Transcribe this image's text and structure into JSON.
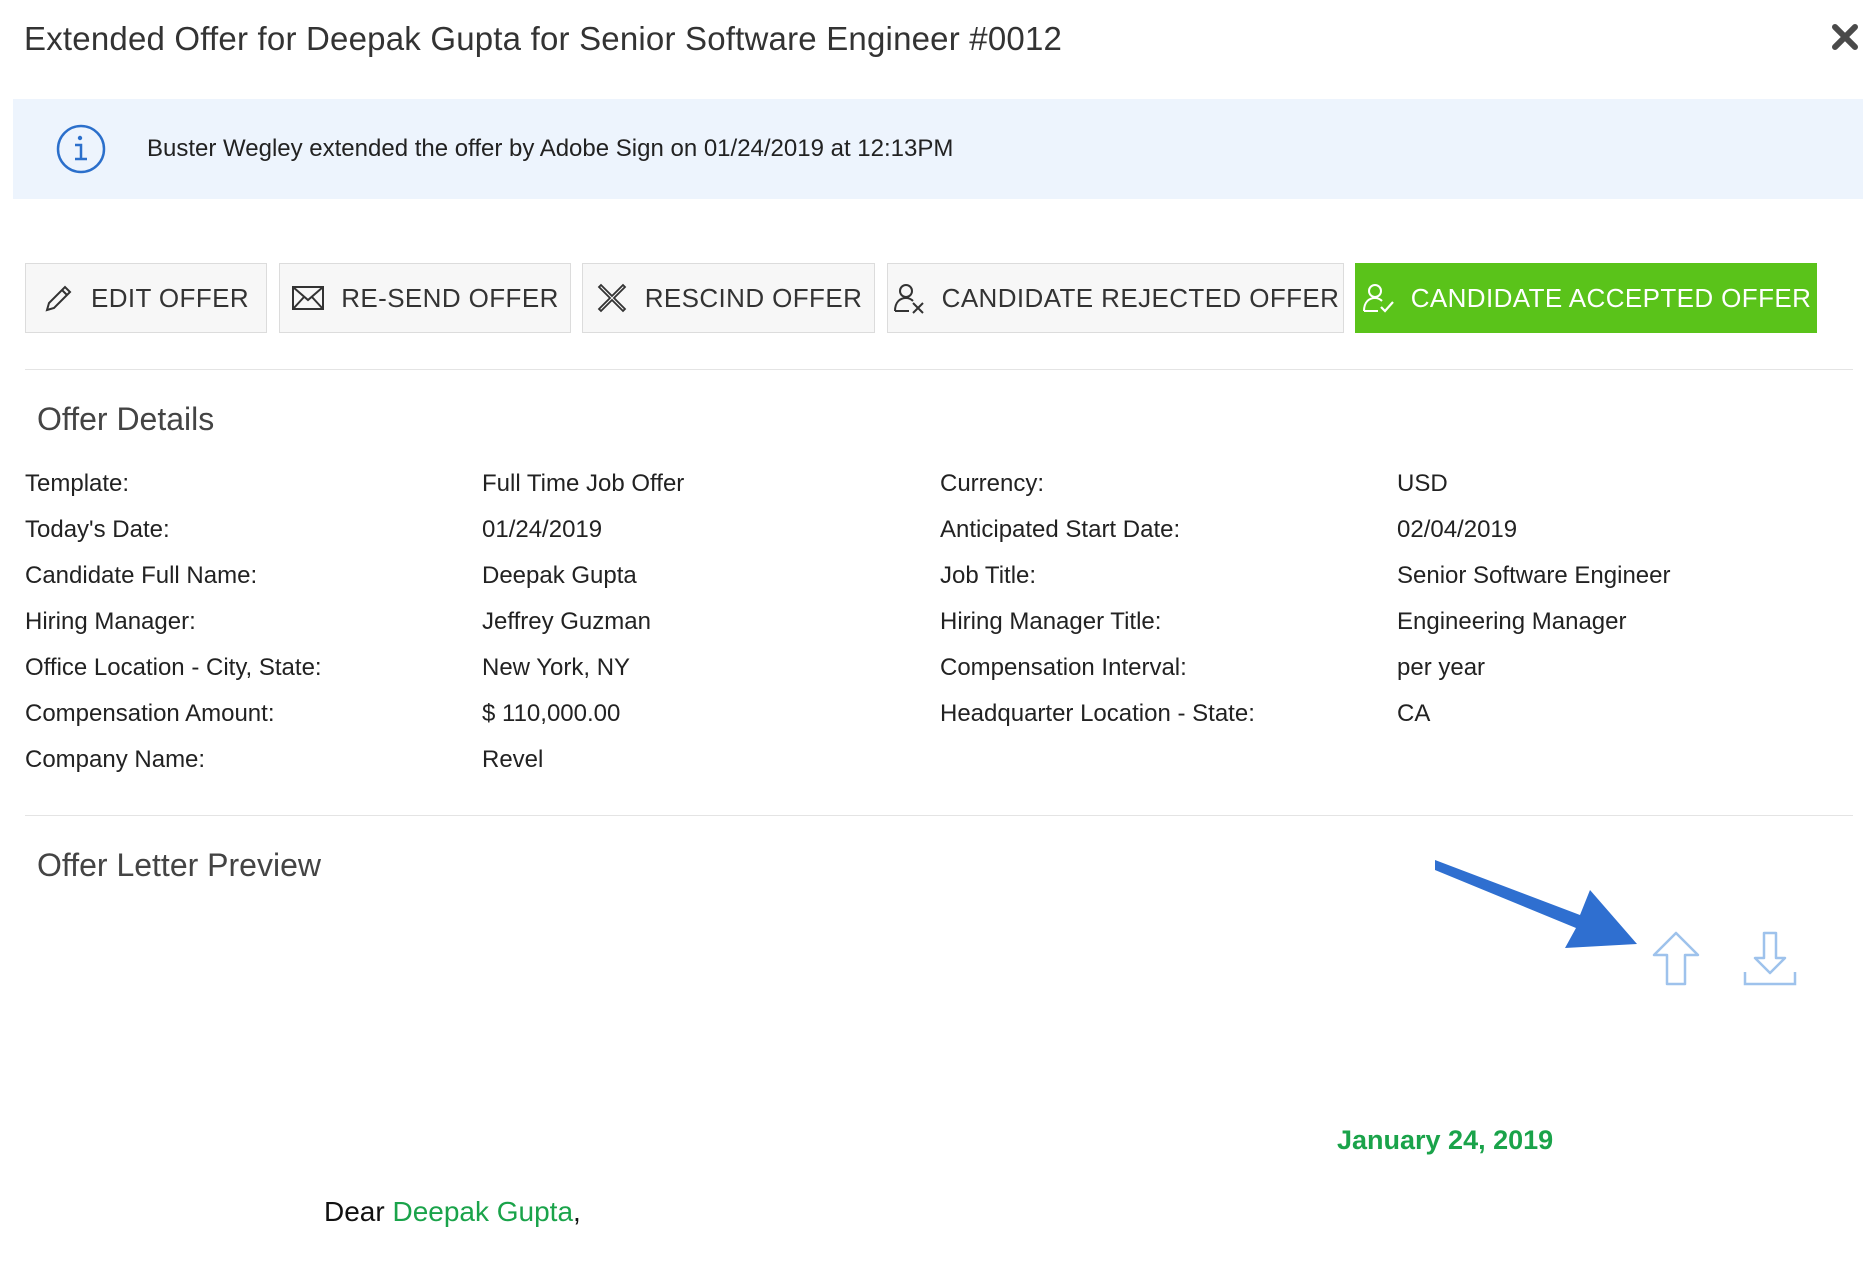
{
  "modal": {
    "title": "Extended Offer for Deepak Gupta for Senior Software Engineer #0012",
    "close_icon": "close-x-icon"
  },
  "banner": {
    "icon": "info-circle-icon",
    "text": "Buster Wegley extended the offer by Adobe Sign on 01/24/2019 at 12:13PM",
    "color": "#edf4fd"
  },
  "actions": {
    "edit": {
      "label": "EDIT OFFER",
      "icon": "pencil-icon"
    },
    "resend": {
      "label": "RE-SEND OFFER",
      "icon": "envelope-icon"
    },
    "rescind": {
      "label": "RESCIND OFFER",
      "icon": "x-cross-icon"
    },
    "rejected": {
      "label": "CANDIDATE REJECTED OFFER",
      "icon": "user-x-icon"
    },
    "accepted": {
      "label": "CANDIDATE ACCEPTED OFFER",
      "icon": "user-check-icon",
      "color": "#5ac31a"
    }
  },
  "offer_details": {
    "heading": "Offer Details",
    "left": [
      {
        "label": "Template:",
        "value": "Full Time Job Offer"
      },
      {
        "label": "Today's Date:",
        "value": "01/24/2019"
      },
      {
        "label": "Candidate Full Name:",
        "value": "Deepak Gupta"
      },
      {
        "label": "Hiring Manager:",
        "value": "Jeffrey Guzman"
      },
      {
        "label": "Office Location - City, State:",
        "value": "New York, NY"
      },
      {
        "label": "Compensation Amount:",
        "value": "$ 110,000.00"
      },
      {
        "label": "Company Name:",
        "value": "Revel"
      }
    ],
    "right": [
      {
        "label": "Currency:",
        "value": "USD"
      },
      {
        "label": "Anticipated Start Date:",
        "value": "02/04/2019"
      },
      {
        "label": "Job Title:",
        "value": "Senior Software Engineer"
      },
      {
        "label": "Hiring Manager Title:",
        "value": "Engineering Manager"
      },
      {
        "label": "Compensation Interval:",
        "value": "per year"
      },
      {
        "label": "Headquarter Location - State:",
        "value": "CA"
      }
    ]
  },
  "offer_letter_preview": {
    "heading": "Offer Letter Preview",
    "upload_icon": "upload-arrow-icon",
    "download_icon": "download-arrow-icon",
    "callout_icon": "blue-callout-arrow-icon",
    "letter_date": "January 24, 2019",
    "salutation_prefix": "Dear ",
    "salutation_name": "Deepak Gupta",
    "salutation_suffix": ",",
    "accent_color": "#1aa34a"
  }
}
